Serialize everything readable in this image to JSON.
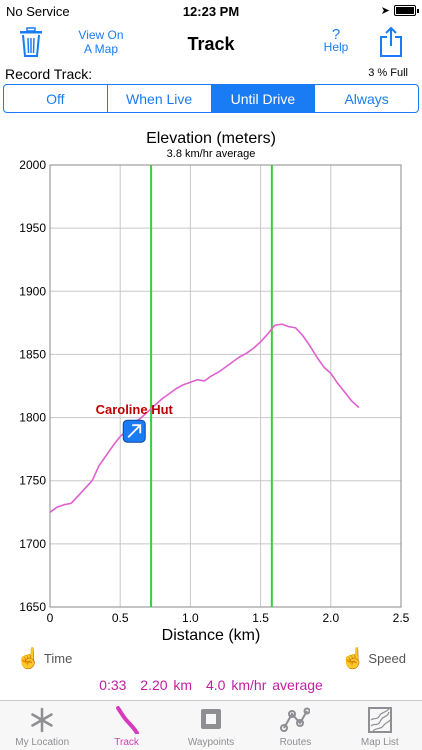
{
  "status": {
    "carrier": "No Service",
    "time": "12:23 PM"
  },
  "nav": {
    "title": "Track",
    "view_map": "View On\nA Map",
    "help_q": "?",
    "help_label": "Help"
  },
  "record": {
    "label": "Record Track:",
    "status": "3 % Full",
    "options": [
      "Off",
      "When Live",
      "Until Drive",
      "Always"
    ],
    "selected": "Until Drive"
  },
  "colors": {
    "accent": "#1a7cf5",
    "track": "#e060d0",
    "marker_line": "#3ccc3c",
    "waypoint_label": "#c00000",
    "summary": "#c020a0",
    "tab_active": "#d63bbd"
  },
  "chart_data": {
    "type": "line",
    "title": "Elevation (meters)",
    "subtitle": "3.8 km/hr average",
    "xlabel": "Distance (km)",
    "ylabel": "",
    "xlim": [
      0,
      2.5
    ],
    "ylim": [
      1650,
      2000
    ],
    "xticks": [
      "0",
      "0.5",
      "1.0",
      "1.5",
      "2.0",
      "2.5"
    ],
    "yticks": [
      "1650",
      "1700",
      "1750",
      "1800",
      "1850",
      "1900",
      "1950",
      "2000"
    ],
    "grid": true,
    "x": [
      0,
      0.05,
      0.1,
      0.15,
      0.2,
      0.25,
      0.3,
      0.35,
      0.4,
      0.45,
      0.5,
      0.55,
      0.6,
      0.65,
      0.7,
      0.75,
      0.8,
      0.85,
      0.9,
      0.95,
      1.0,
      1.05,
      1.1,
      1.15,
      1.2,
      1.25,
      1.3,
      1.35,
      1.4,
      1.45,
      1.5,
      1.55,
      1.6,
      1.65,
      1.7,
      1.75,
      1.8,
      1.85,
      1.9,
      1.95,
      2.0,
      2.05,
      2.1,
      2.15,
      2.2
    ],
    "y": [
      1725,
      1729,
      1731,
      1732,
      1738,
      1744,
      1750,
      1762,
      1770,
      1778,
      1785,
      1790,
      1796,
      1800,
      1805,
      1810,
      1815,
      1819,
      1823,
      1826,
      1828,
      1830,
      1829,
      1833,
      1836,
      1840,
      1844,
      1848,
      1851,
      1855,
      1860,
      1866,
      1873,
      1874,
      1872,
      1871,
      1865,
      1857,
      1848,
      1840,
      1835,
      1827,
      1820,
      1813,
      1808
    ],
    "vertical_markers": [
      0.72,
      1.58
    ],
    "waypoint": {
      "label": "Caroline Hut",
      "x": 0.6,
      "y": 1790
    }
  },
  "controls": {
    "time": "Time",
    "speed": "Speed"
  },
  "summary": {
    "time": "0:33",
    "distance": "2.20 km",
    "speed": "4.0 km/hr average"
  },
  "tabs": [
    {
      "label": "My Location",
      "icon": "snowflake-icon"
    },
    {
      "label": "Track",
      "icon": "track-icon"
    },
    {
      "label": "Waypoints",
      "icon": "waypoint-square-icon"
    },
    {
      "label": "Routes",
      "icon": "route-icon"
    },
    {
      "label": "Map List",
      "icon": "map-icon"
    }
  ],
  "active_tab": "Track"
}
